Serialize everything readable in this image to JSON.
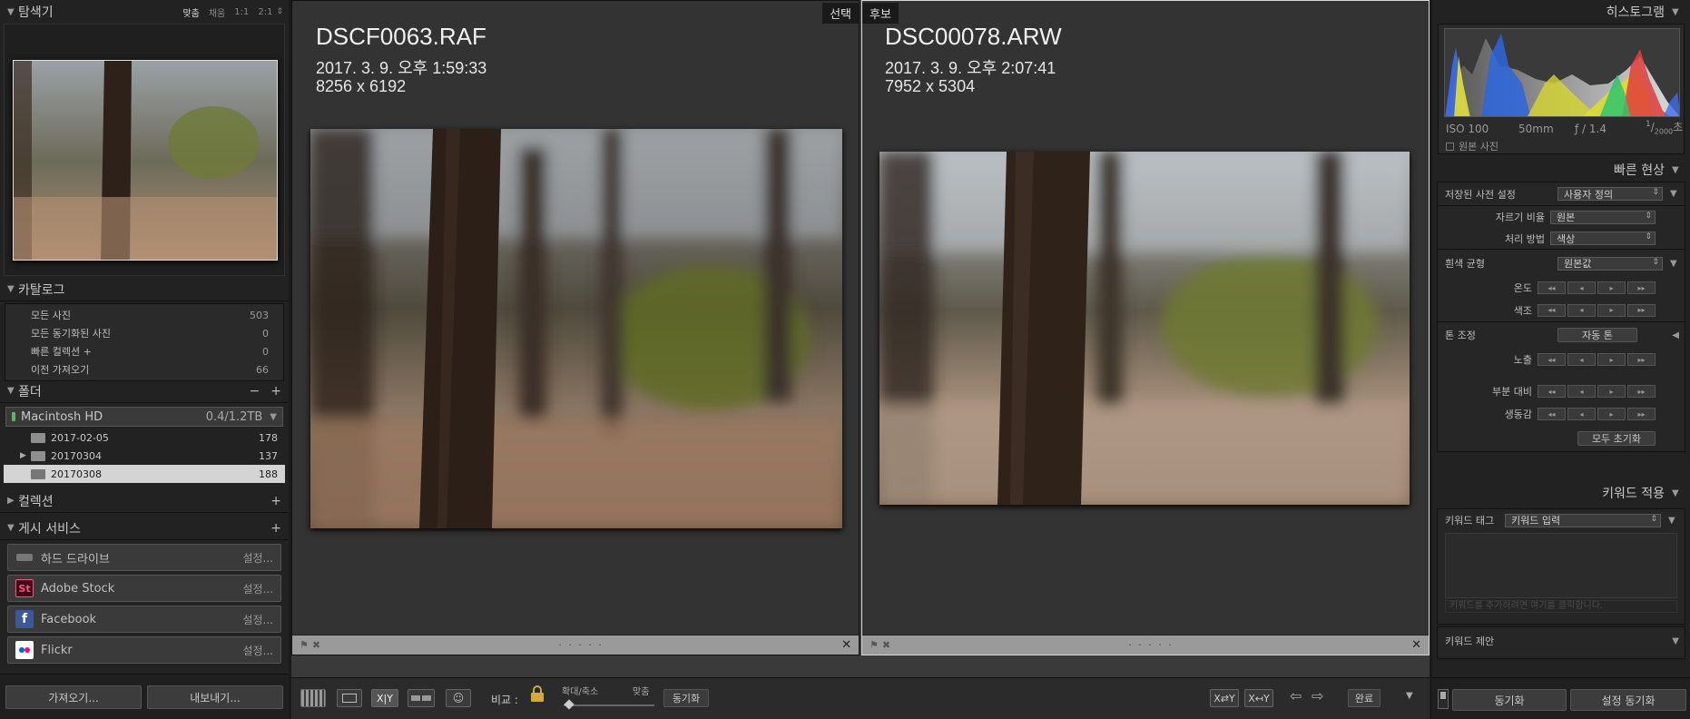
{
  "left": {
    "navigator": {
      "title": "탐색기",
      "zoom": [
        "맞춤",
        "채움",
        "1:1",
        "2:1"
      ],
      "zoom_more": "⇕"
    },
    "catalog": {
      "title": "카탈로그",
      "items": [
        {
          "label": "모든 사진",
          "count": "503"
        },
        {
          "label": "모든 동기화된 사진",
          "count": "0"
        },
        {
          "label": "빠른 컬렉션 +",
          "count": "0"
        },
        {
          "label": "이전 가져오기",
          "count": "66"
        }
      ]
    },
    "folders": {
      "title": "폴더",
      "volume": "Macintosh HD",
      "volume_size": "0.4/1.2TB",
      "items": [
        {
          "name": "2017-02-05",
          "count": "178"
        },
        {
          "name": "20170304",
          "count": "137"
        },
        {
          "name": "20170308",
          "count": "188"
        }
      ]
    },
    "collections": {
      "title": "컬렉션"
    },
    "publish": {
      "title": "게시 서비스",
      "services": [
        {
          "name": "하드 드라이브",
          "icon": "hard-drive-icon",
          "setup": "설정..."
        },
        {
          "name": "Adobe Stock",
          "icon": "adobe-stock-icon",
          "setup": "설정...",
          "icon_text": "St"
        },
        {
          "name": "Facebook",
          "icon": "facebook-icon",
          "setup": "설정...",
          "icon_text": "f"
        },
        {
          "name": "Flickr",
          "icon": "flickr-icon",
          "setup": "설정..."
        }
      ]
    },
    "import_label": "가져오기...",
    "export_label": "내보내기..."
  },
  "center": {
    "select_tag": "선택",
    "candidate_tag": "후보",
    "left_photo": {
      "filename": "DSCF0063.RAF",
      "date": "2017. 3. 9. 오후 1:59:33",
      "dims": "8256 x 6192"
    },
    "right_photo": {
      "filename": "DSC00078.ARW",
      "date": "2017. 3. 9. 오후 2:07:41",
      "dims": "7952 x 5304"
    },
    "strip_dots": "· · · · ·"
  },
  "toolbar": {
    "compare_label": "비교 :",
    "zoom_label": "확대/축소",
    "fit_label": "맞춤",
    "sync_label": "동기화",
    "done_label": "완료",
    "zoom_level": 0.02
  },
  "right": {
    "histogram": {
      "title": "히스토그램",
      "iso": "ISO 100",
      "focal": "50mm",
      "aperture": "ƒ / 1.4",
      "shutter_num": "1",
      "shutter_den": "2000",
      "shutter_unit": "초",
      "original": "원본 사진"
    },
    "quick": {
      "title": "빠른 현상",
      "preset_label": "저장된 사전 설정",
      "preset_value": "사용자 정의",
      "crop_label": "자르기 비율",
      "crop_value": "원본",
      "treat_label": "처리 방법",
      "treat_value": "색상",
      "wb_label": "흰색 균형",
      "wb_value": "원본값",
      "temp_label": "온도",
      "tint_label": "색조",
      "tone_label": "톤 조정",
      "auto_tone": "자동 톤",
      "exposure_label": "노출",
      "clarity_label": "부분 대비",
      "vibrance_label": "생동감",
      "reset_all": "모두 초기화"
    },
    "keywords": {
      "title": "키워드 적용",
      "tag_label": "키워드 태그",
      "tag_value": "키워드 입력",
      "hint": "키워드를 추가하려면 여기를 클릭합니다.",
      "suggest": "키워드 제안"
    },
    "sync_label": "동기화",
    "sync_settings_label": "설정 동기화"
  },
  "colors": {
    "bg": "#333333",
    "panel": "#222222",
    "accent": "#e8e8e8"
  }
}
